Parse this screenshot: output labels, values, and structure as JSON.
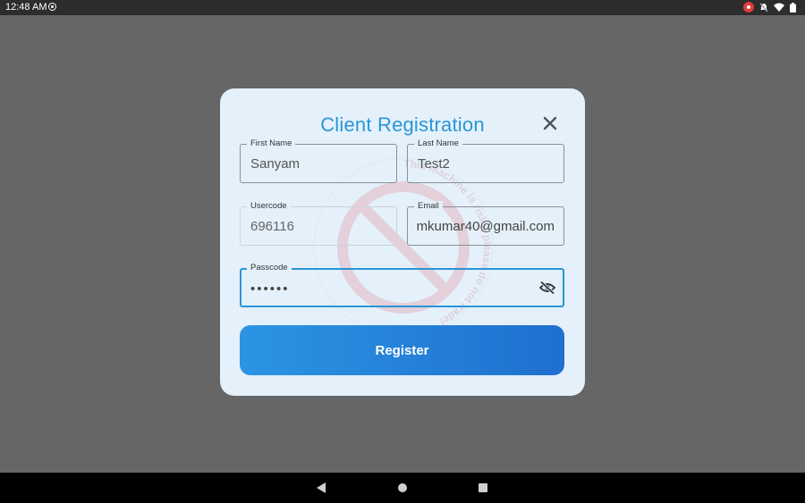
{
  "status_bar": {
    "time": "12:48 AM"
  },
  "dialog": {
    "title": "Client Registration",
    "watermark_text": "This machine is risky, please do not trade!",
    "fields": {
      "first_name": {
        "label": "First Name",
        "value": "Sanyam"
      },
      "last_name": {
        "label": "Last Name",
        "value": "Test2"
      },
      "usercode": {
        "label": "Usercode",
        "value": "696116"
      },
      "email": {
        "label": "Email",
        "value": "mkumar40@gmail.com"
      },
      "passcode": {
        "label": "Passcode",
        "value": "••••••"
      }
    },
    "register_label": "Register"
  },
  "colors": {
    "accent": "#2b95d6",
    "dialog_bg": "#e4f1fb",
    "scrim": "#666666",
    "button_start": "#2b95e3",
    "button_end": "#1f6fcf"
  }
}
